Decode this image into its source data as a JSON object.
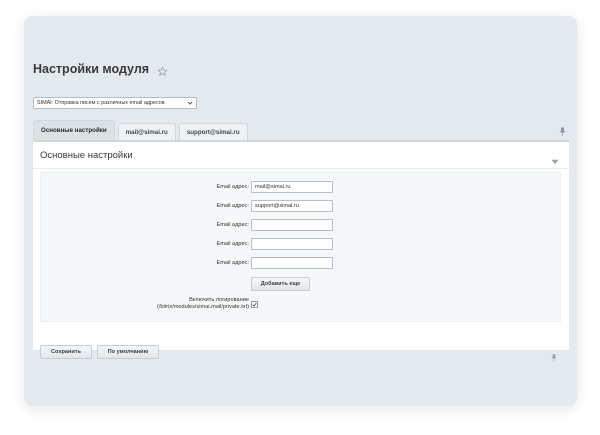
{
  "page": {
    "title": "Настройки модуля"
  },
  "module_select": {
    "value": "SIMAI: Отправка писем с различных email адресов"
  },
  "tabs": [
    {
      "label": "Основные настройки",
      "active": true
    },
    {
      "label": "mail@simai.ru",
      "active": false
    },
    {
      "label": "support@simai.ru",
      "active": false
    }
  ],
  "panel": {
    "title": "Основные настройки"
  },
  "form": {
    "email_label": "Email адрес:",
    "emails": [
      "mail@simai.ru",
      "support@simai.ru",
      "",
      "",
      ""
    ],
    "add_more_label": "Добавить еще",
    "logging_label_line1": "Включить логирование",
    "logging_label_line2": "(/bitrix/modules/simai.mail/private.txt)",
    "logging_checked": true
  },
  "buttons": {
    "save": "Сохранить",
    "default": "По умолчанию"
  },
  "icons": {
    "favorite": "star-outline-icon",
    "select_arrow": "chevron-down-icon",
    "pin": "pin-icon",
    "collapse": "triangle-down-icon",
    "checkbox": "checkmark-icon"
  },
  "colors": {
    "window_bg": "#e3e9ec",
    "panel_bg": "#ffffff",
    "form_bg": "#f5f7f8",
    "button_border": "#c6ced3"
  }
}
